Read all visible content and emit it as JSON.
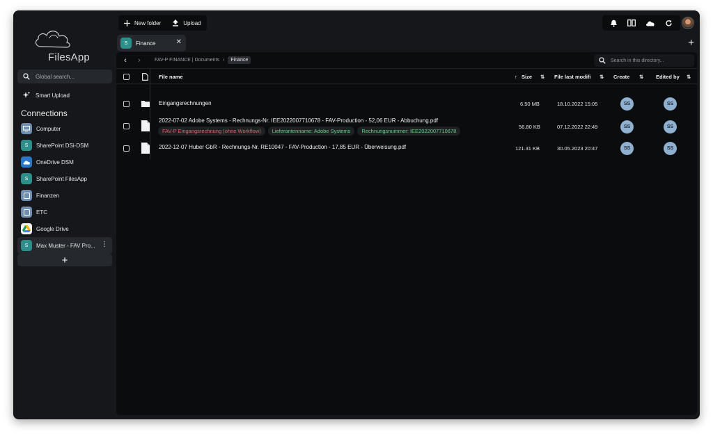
{
  "app": {
    "name": "FilesApp"
  },
  "sidebar": {
    "search_placeholder": "Global search...",
    "smart_upload": "Smart Upload",
    "connections_title": "Connections",
    "connections": [
      {
        "label": "Computer",
        "icon": "computer-icon",
        "color": "#6f8fb3"
      },
      {
        "label": "SharePoint DSi-DSM",
        "icon": "sharepoint-icon",
        "color": "#2e8f8a"
      },
      {
        "label": "OneDrive DSM",
        "icon": "onedrive-icon",
        "color": "#2b78c6"
      },
      {
        "label": "SharePoint FilesApp",
        "icon": "sharepoint-icon",
        "color": "#2e8f8a"
      },
      {
        "label": "Finanzen",
        "icon": "folder-box-icon",
        "color": "#6f8fb3"
      },
      {
        "label": "ETC",
        "icon": "folder-box-icon",
        "color": "#6f8fb3"
      },
      {
        "label": "Google Drive",
        "icon": "google-drive-icon",
        "color": "#f2f2f2"
      },
      {
        "label": "Max Muster - FAV Pro...",
        "icon": "sharepoint-icon",
        "color": "#2e8f8a"
      }
    ],
    "add_label": "+"
  },
  "toolbar": {
    "new_folder": "New folder",
    "upload": "Upload",
    "right_icons": [
      "bell-icon",
      "columns-icon",
      "cloud-icon",
      "refresh-icon"
    ]
  },
  "tabs": [
    {
      "label": "Finance",
      "close": "✕"
    }
  ],
  "tab_add": "+",
  "breadcrumb": {
    "path": "FAV-P FINANCE | Documents",
    "separator": "›",
    "current": "Finance"
  },
  "dir_search_placeholder": "Search in this directory...",
  "table": {
    "columns": {
      "name": "File name",
      "size": "Size",
      "modified": "File last modifi",
      "created": "Create",
      "edited": "Edited by"
    },
    "rows": [
      {
        "type": "folder",
        "name": "Eingangsrechnungen",
        "size": "6.50 MB",
        "modified": "18.10.2022 15:05",
        "created_by": "SS",
        "edited_by": "SS",
        "tags": []
      },
      {
        "type": "file",
        "name": "2022-07-02 Adobe Systems - Rechnungs-Nr. IEE2022007710678 - FAV-Production - 52,06 EUR - Abbuchung.pdf",
        "size": "56.80 KB",
        "modified": "07.12.2022 22:49",
        "created_by": "SS",
        "edited_by": "SS",
        "tags": [
          {
            "text": "FAV-P Eingangsrechnung (ohne Workflow)",
            "color": "#e0676b"
          },
          {
            "text": "Lieferantenname: Adobe Systems",
            "color": "#6fcf86"
          },
          {
            "text": "Rechnungsnummer: IEE2022007710678",
            "color": "#6fcf86"
          }
        ]
      },
      {
        "type": "file",
        "name": "2022-12-07 Huber GbR - Rechnungs-Nr. RE10047 - FAV-Production - 17,85 EUR - Überweisung.pdf",
        "size": "121.31 KB",
        "modified": "30.05.2023 20:47",
        "created_by": "SS",
        "edited_by": "SS",
        "tags": []
      }
    ]
  }
}
